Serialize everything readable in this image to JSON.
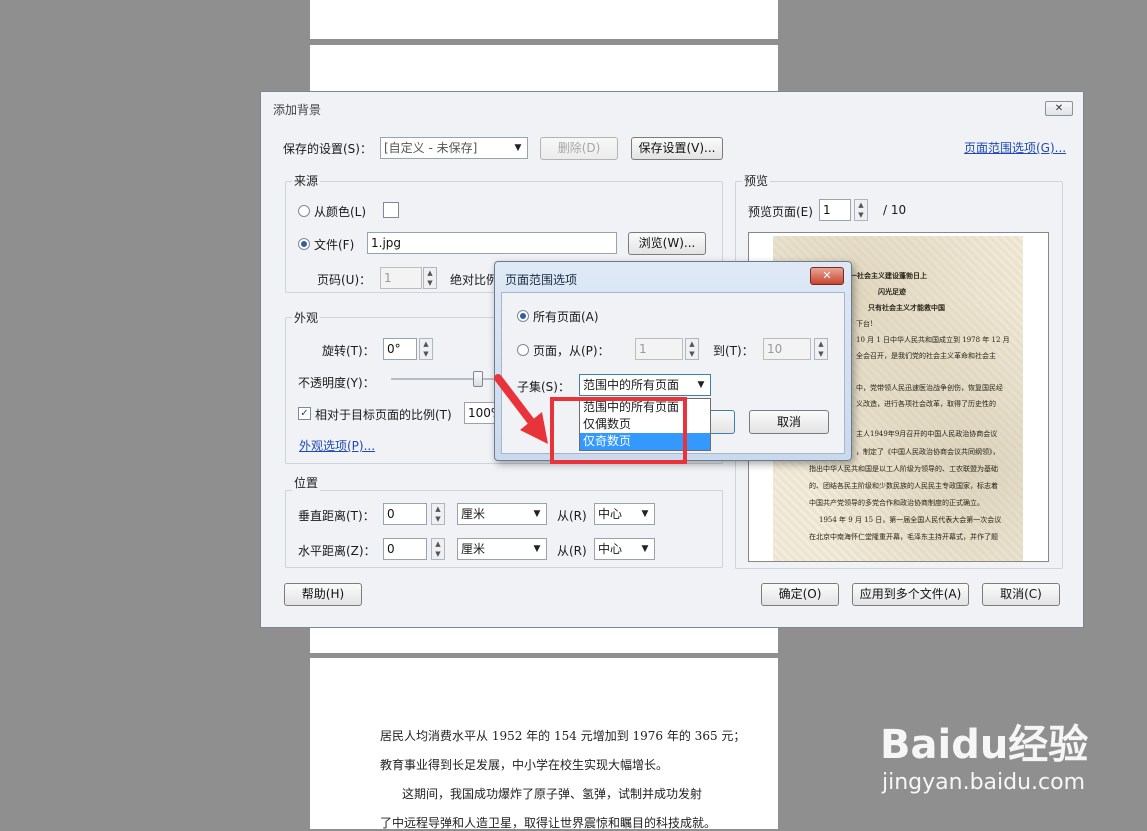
{
  "main_dialog": {
    "title": "添加背景",
    "saved_settings_label": "保存的设置(S)：",
    "saved_settings_value": "[自定义 - 未保存]",
    "delete_button": "删除(D)",
    "save_settings_button": "保存设置(V)...",
    "page_range_link": "页面范围选项(G)...",
    "source": {
      "group_title": "来源",
      "from_color_label": "从颜色(L)",
      "file_label": "文件(F)",
      "file_value": "1.jpg",
      "browse_button": "浏览(W)...",
      "page_number_label": "页码(U)：",
      "page_number_value": "1",
      "absolute_scale_label": "绝对比例"
    },
    "appearance": {
      "group_title": "外观",
      "rotation_label": "旋转(T)：",
      "rotation_value": "0°",
      "opacity_label": "不透明度(Y)：",
      "opacity_level": 0.98,
      "relative_scale_label": "相对于目标页面的比例(T)",
      "relative_scale_value": "100%",
      "appearance_options_link": "外观选项(P)..."
    },
    "position": {
      "group_title": "位置",
      "vertical_label": "垂直距离(T)：",
      "vertical_value": "0",
      "vertical_unit": "厘米",
      "vertical_from_label": "从(R)",
      "vertical_from_value": "中心",
      "horizontal_label": "水平距离(Z)：",
      "horizontal_value": "0",
      "horizontal_unit": "厘米",
      "horizontal_from_label": "从(R)",
      "horizontal_from_value": "中心"
    },
    "preview": {
      "group_title": "预览",
      "preview_page_label": "预览页面(E)",
      "preview_page_value": "1",
      "total_pages": "/ 10",
      "lines": [
        "第一社会主义建设蓬勃日上",
        "闪光足迹",
        "只有社会主义才能救中国",
        "下台!",
        "10 月 1 日中华人民共和国成立到 1978 年 12 月",
        "全会召开，是我们党的社会主义革命和社会主",
        "中，党带领人民迅速医治战争创伤，恢复国民经",
        "义改造，进行各项社会改革，取得了历史性的",
        "主人1949年9月召开的中国人民政治协商会议",
        "，制定了《中国人民政治协商会议共同纲领》，",
        "指出中华人民共和国是以工人阶级为领导的、工农联盟为基础",
        "的、团结各民主阶级和少数民族的人民民主专政国家，标志着",
        "中国共产党领导的多党合作和政治协商制度的正式确立。",
        "1954 年 9 月 15 日，第一届全国人民代表大会第一次会议",
        "在北京中南海怀仁堂隆重开幕，毛泽东主持开幕式，并作了题"
      ]
    },
    "help_button": "帮助(H)",
    "ok_button": "确定(O)",
    "apply_multiple_button": "应用到多个文件(A)",
    "cancel_button": "取消(C)"
  },
  "page_range_dialog": {
    "title": "页面范围选项",
    "close_glyph": "✕",
    "all_pages_label": "所有页面(A)",
    "pages_from_label": "页面，从(P)：",
    "from_value": "1",
    "to_label": "到(T)：",
    "to_value": "10",
    "subset_label": "子集(S)：",
    "subset_value": "范围中的所有页面",
    "options": [
      "范围中的所有页面",
      "仅偶数页",
      "仅奇数页"
    ],
    "selected_option_index": 2,
    "cancel_button": "取消"
  },
  "background_document": {
    "lines": [
      "居民人均消费水平从 1952 年的 154 元增加到 1976 年的 365 元；",
      "教育事业得到长足发展，中小学在校生实现大幅增长。",
      "这期间，我国成功爆炸了原子弹、氢弹，试制并成功发射",
      "了中远程导弹和人造卫星，取得让世界震惊和瞩目的科技成就。"
    ]
  },
  "watermark": {
    "logo_text": "Baidu经验",
    "url": "jingyan.baidu.com"
  },
  "colors": {
    "highlight_box": "#e8333a",
    "annotation_arrow": "#e8333a",
    "selected_option": "#3399ff",
    "link": "#1f4ab5"
  }
}
